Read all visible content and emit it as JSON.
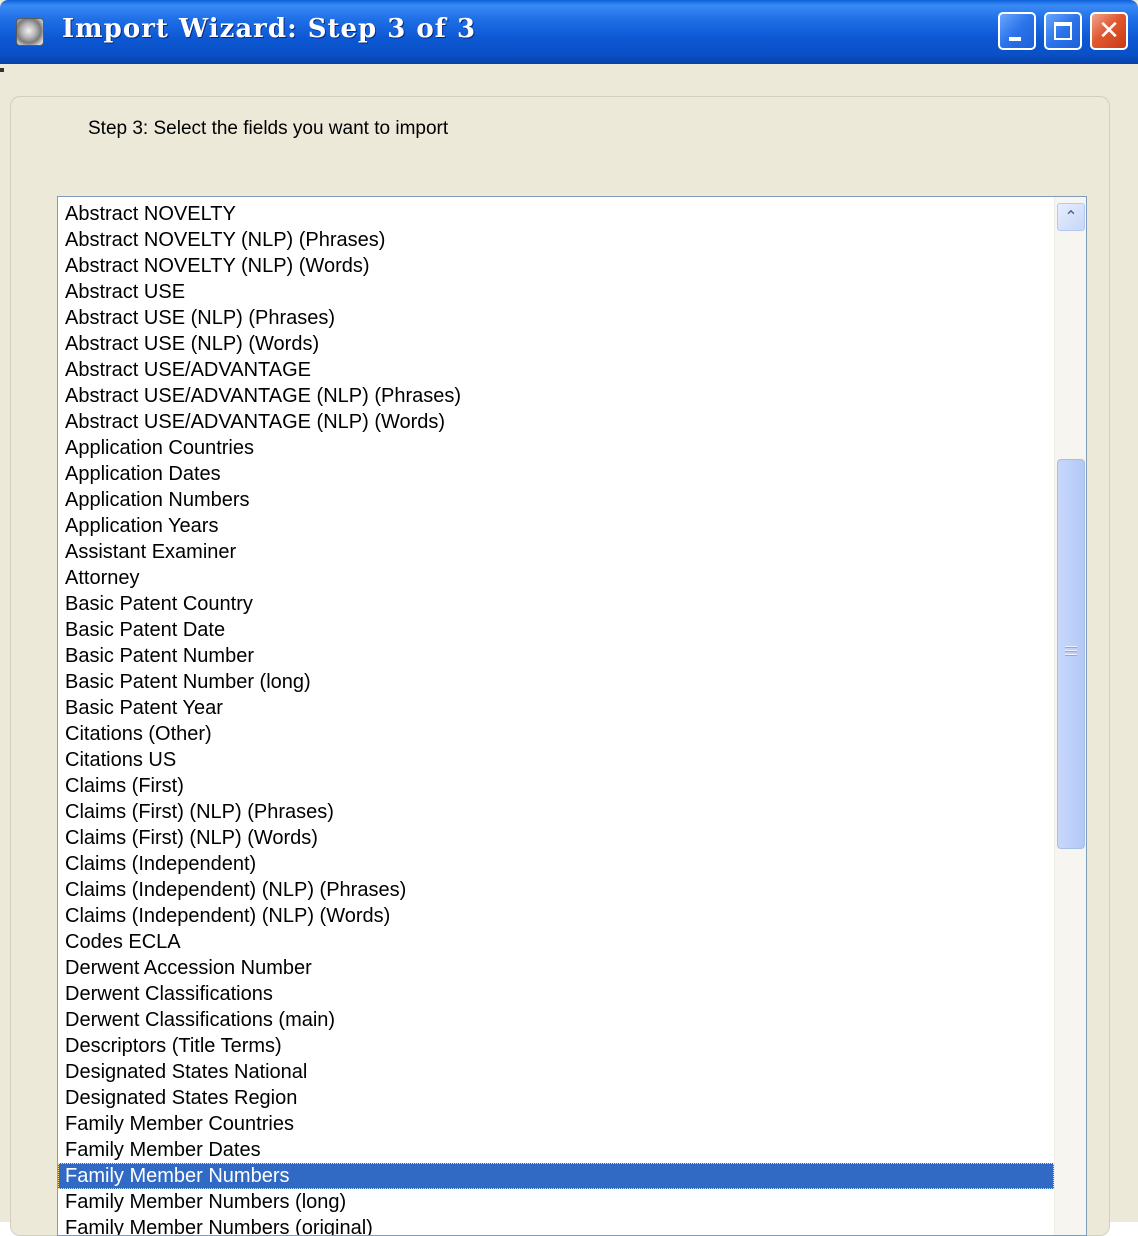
{
  "window": {
    "title": "Import Wizard: Step 3 of 3",
    "title_icon": "app-icon",
    "controls": {
      "minimize_icon": "minimize-icon",
      "maximize_icon": "maximize-icon",
      "close_icon": "close-icon",
      "close_glyph": "✕"
    }
  },
  "step": {
    "instruction": "Step 3: Select the fields you want to import"
  },
  "field_list": {
    "selected_item": "Family Member Numbers",
    "scroll_up_glyph": "⌃",
    "items": [
      "Abstract NOVELTY",
      "Abstract NOVELTY (NLP) (Phrases)",
      "Abstract NOVELTY (NLP) (Words)",
      "Abstract USE",
      "Abstract USE (NLP) (Phrases)",
      "Abstract USE (NLP) (Words)",
      "Abstract USE/ADVANTAGE",
      "Abstract USE/ADVANTAGE (NLP) (Phrases)",
      "Abstract USE/ADVANTAGE (NLP) (Words)",
      "Application Countries",
      "Application Dates",
      "Application Numbers",
      "Application Years",
      "Assistant Examiner",
      "Attorney",
      "Basic Patent Country",
      "Basic Patent Date",
      "Basic Patent Number",
      "Basic Patent Number (long)",
      "Basic Patent Year",
      "Citations (Other)",
      "Citations US",
      "Claims (First)",
      "Claims (First) (NLP) (Phrases)",
      "Claims (First) (NLP) (Words)",
      "Claims (Independent)",
      "Claims (Independent) (NLP) (Phrases)",
      "Claims (Independent) (NLP) (Words)",
      "Codes ECLA",
      "Derwent Accession Number",
      "Derwent Classifications",
      "Derwent Classifications (main)",
      "Descriptors (Title Terms)",
      "Designated States National",
      "Designated States Region",
      "Family Member Countries",
      "Family Member Dates",
      "Family Member Numbers",
      "Family Member Numbers (long)",
      "Family Member Numbers (original)"
    ]
  },
  "colors": {
    "titlebar": "#0a50c6",
    "selection": "#316ac5",
    "dialog_background": "#ece9d8",
    "close_button": "#e0582f"
  }
}
